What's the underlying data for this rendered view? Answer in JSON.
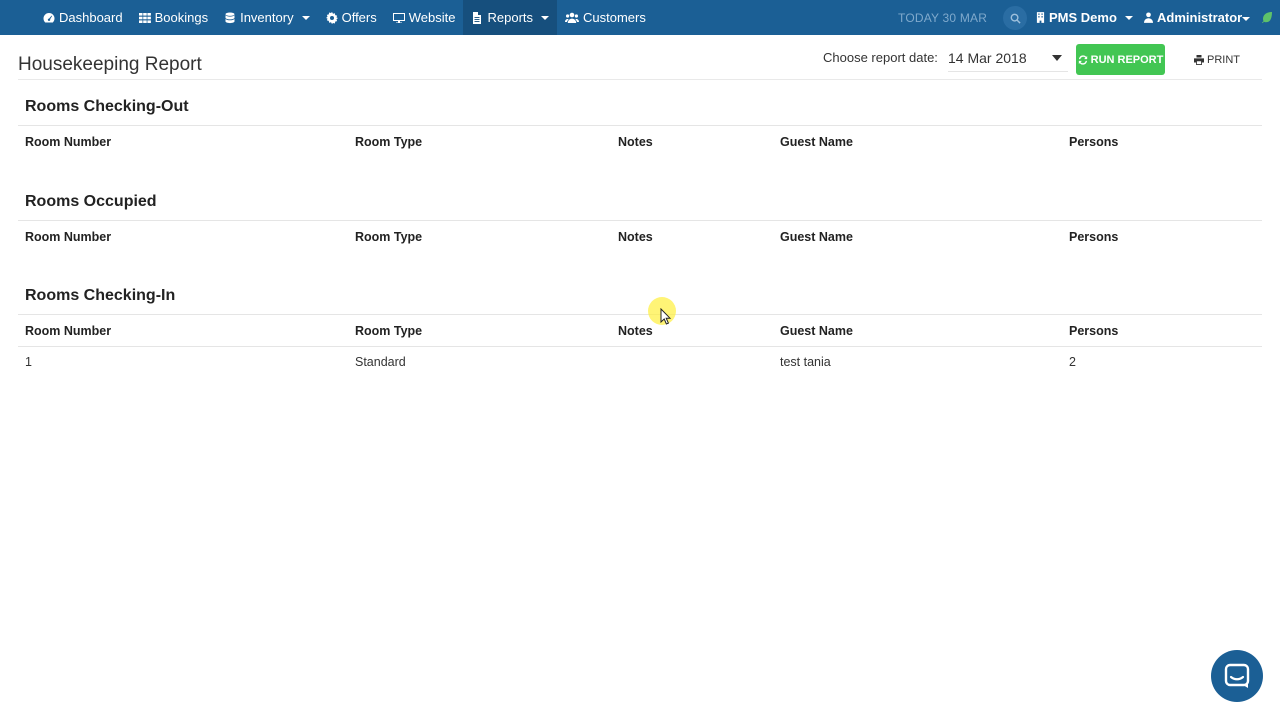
{
  "nav": {
    "items": [
      {
        "label": "Dashboard",
        "icon": "dashboard-icon",
        "dropdown": false
      },
      {
        "label": "Bookings",
        "icon": "grid-icon",
        "dropdown": false
      },
      {
        "label": "Inventory",
        "icon": "database-icon",
        "dropdown": true
      },
      {
        "label": "Offers",
        "icon": "gear-icon",
        "dropdown": false
      },
      {
        "label": "Website",
        "icon": "monitor-icon",
        "dropdown": false
      },
      {
        "label": "Reports",
        "icon": "file-icon",
        "dropdown": true,
        "active": true
      },
      {
        "label": "Customers",
        "icon": "users-icon",
        "dropdown": false
      }
    ],
    "today": "TODAY 30 MAR",
    "property": "PMS Demo",
    "user": "Administrator"
  },
  "header": {
    "title": "Housekeeping Report",
    "date_label": "Choose report date:",
    "date_value": "14 Mar 2018",
    "run_label": "RUN REPORT",
    "print_label": "PRINT"
  },
  "columns": [
    "Room Number",
    "Room Type",
    "Notes",
    "Guest Name",
    "Persons"
  ],
  "sections": [
    {
      "title": "Rooms Checking-Out",
      "rows": []
    },
    {
      "title": "Rooms Occupied",
      "rows": []
    },
    {
      "title": "Rooms Checking-In",
      "rows": [
        {
          "room_number": "1",
          "room_type": "Standard",
          "notes": "",
          "guest_name": "test tania",
          "persons": "2"
        }
      ]
    }
  ],
  "colors": {
    "nav_bg": "#1b5f95",
    "nav_active": "#164f7d",
    "run_button": "#42c653",
    "chat_bubble": "#1b5f95"
  }
}
